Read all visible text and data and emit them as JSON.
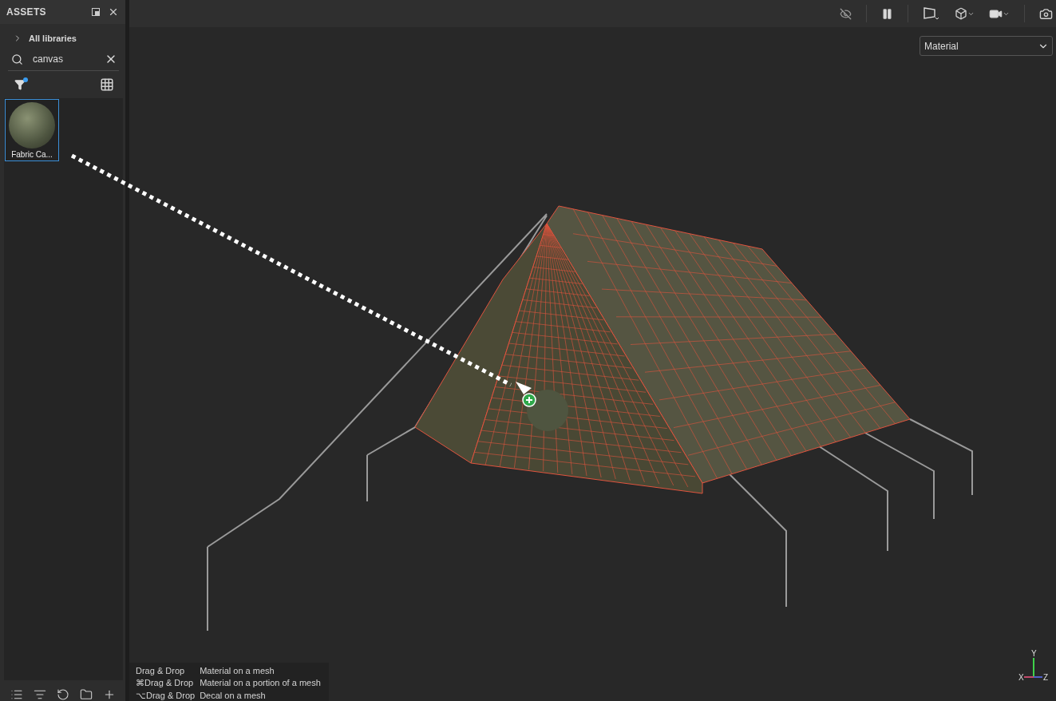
{
  "panel": {
    "title": "ASSETS",
    "breadcrumb": "All libraries",
    "search": {
      "value": "canvas"
    },
    "filter_active": true,
    "assets": [
      {
        "name": "Fabric Ca...",
        "selected": true
      }
    ]
  },
  "viewport": {
    "render_mode": "Material",
    "hints": [
      {
        "gesture": "Drag & Drop",
        "action": "Material on a mesh"
      },
      {
        "gesture": "⌘Drag & Drop",
        "action": "Material on a portion of a mesh"
      },
      {
        "gesture": "⌥Drag & Drop",
        "action": "Decal on a mesh"
      }
    ],
    "axes": [
      "X",
      "Y",
      "Z"
    ]
  }
}
